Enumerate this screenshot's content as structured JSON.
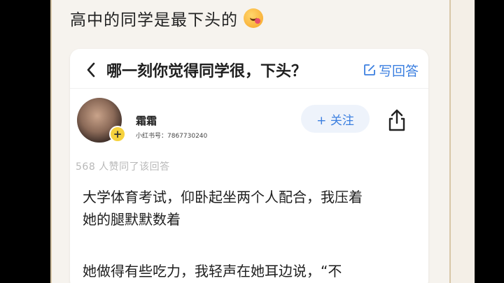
{
  "post": {
    "text": "高中的同学是最下头的"
  },
  "question": {
    "title": "哪一刻你觉得同学很，下头？",
    "write_answer_label": "写回答"
  },
  "author": {
    "name": "霜霜",
    "id_text": "小红书号：7867730240",
    "follow_label": "+ 关注"
  },
  "answer": {
    "likes": "568 人赞同了该回答",
    "lines": [
      "大学体育考试，仰卧起坐两个人配合，我压着",
      "她的腿默默数着",
      "她做得有些吃力，我轻声在她耳边说，“不"
    ]
  },
  "colors": {
    "accent": "#3b7fe0",
    "follow_bg": "#eef3fb",
    "frame": "#d8c7a8"
  }
}
